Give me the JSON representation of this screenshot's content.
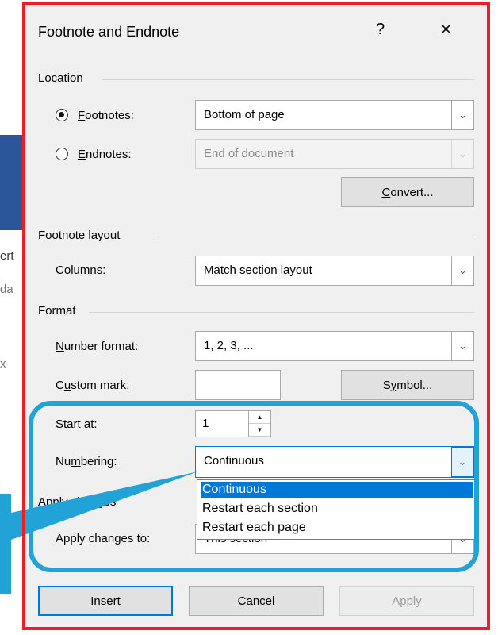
{
  "background": {
    "fragments": [
      "ert",
      "da",
      "x"
    ]
  },
  "dialog": {
    "title": "Footnote and Endnote",
    "help_label": "?",
    "close_label": "×"
  },
  "location": {
    "header": "Location",
    "footnotes": {
      "label_prefix": "",
      "label_accel": "F",
      "label_rest": "ootnotes:",
      "value": "Bottom of page",
      "selected": true
    },
    "endnotes": {
      "label_accel": "E",
      "label_rest": "ndnotes:",
      "value": "End of document",
      "selected": false
    },
    "convert": {
      "label_accel": "C",
      "label_rest": "onvert..."
    }
  },
  "footnote_layout": {
    "header": "Footnote layout",
    "columns": {
      "label_pre": "C",
      "label_accel": "o",
      "label_rest": "lumns:",
      "value": "Match section layout"
    }
  },
  "format": {
    "header": "Format",
    "number_format": {
      "label_accel": "N",
      "label_rest": "umber format:",
      "value": "1, 2, 3, ..."
    },
    "custom_mark": {
      "label_pre": "C",
      "label_accel": "u",
      "label_rest": "stom mark:",
      "value": ""
    },
    "symbol": {
      "label_pre": "S",
      "label_accel": "y",
      "label_rest": "mbol..."
    },
    "start_at": {
      "label_accel": "S",
      "label_rest": "tart at:",
      "value": "1"
    },
    "numbering": {
      "label_pre": "Nu",
      "label_accel": "m",
      "label_rest": "bering:",
      "value": "Continuous"
    },
    "numbering_options": [
      "Continuous",
      "Restart each section",
      "Restart each page"
    ]
  },
  "apply_changes": {
    "header": "Apply changes",
    "label": "Apply changes to:",
    "value": "This section"
  },
  "buttons": {
    "insert": {
      "label_accel": "I",
      "label_rest": "nsert"
    },
    "cancel": "Cancel",
    "apply": "Apply"
  },
  "colors": {
    "frame": "#ee1c25",
    "highlight": "#21a3d8",
    "selection": "#0078d7"
  }
}
